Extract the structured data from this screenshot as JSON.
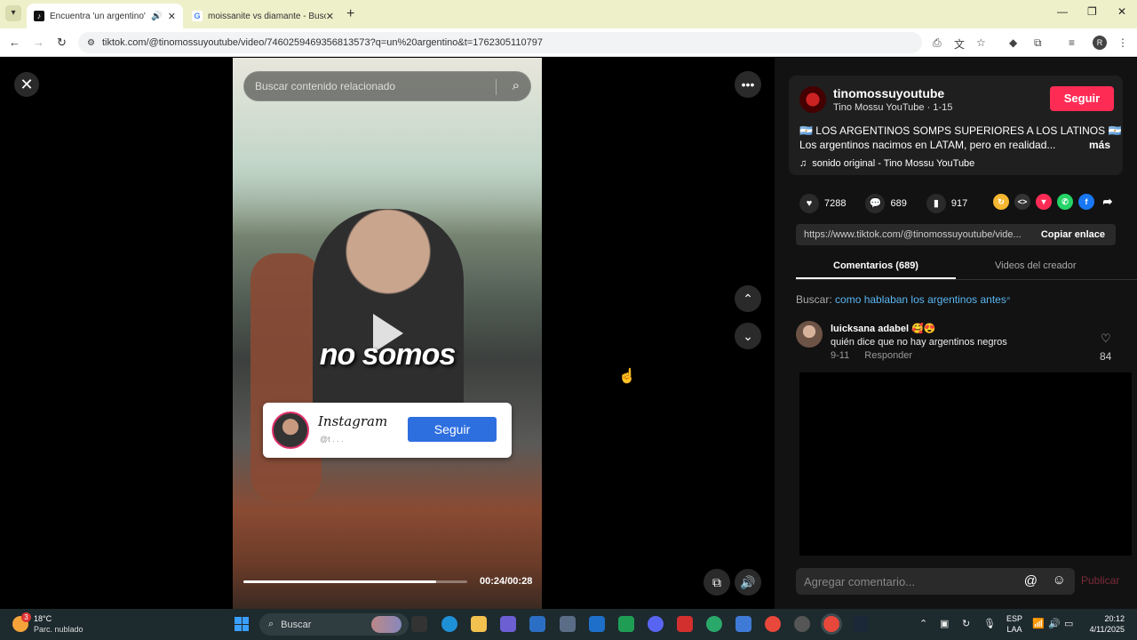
{
  "browser": {
    "tabs": [
      {
        "title": "Encuentra 'un argentino' en",
        "active": true
      },
      {
        "title": "moissanite vs diamante - Busca",
        "active": false
      }
    ],
    "new_tab": "+",
    "url": "tiktok.com/@tinomossuyoutube/video/7460259469356813573?q=un%20argentino&t=1762305110797"
  },
  "video": {
    "search_placeholder": "Buscar contenido relacionado",
    "caption": "no somos",
    "ig_card": {
      "name": "Instagram",
      "handle": "@t . . .",
      "follow": "Seguir"
    },
    "time": "00:24/00:28",
    "progress_fraction": 0.86
  },
  "panel": {
    "creator_name": "tinomossuyoutube",
    "creator_sub": "Tino Mossu YouTube · 1-15",
    "follow_label": "Seguir",
    "desc_line1": "🇦🇷 LOS ARGENTINOS SOMPS SUPERIORES A LOS LATINOS 🇦🇷",
    "desc_line2": "Los argentinos nacimos en LATAM, pero en realidad...",
    "more_label": "más",
    "sound": "sonido original - Tino Mossu YouTube",
    "likes": "7288",
    "comments": "689",
    "saves": "917",
    "share_link": "https://www.tiktok.com/@tinomossuyoutube/vide...",
    "copy_label": "Copiar enlace",
    "tab_comments": "Comentarios (689)",
    "tab_creator": "Videos del creador",
    "search_prefix": "Buscar:",
    "search_term": "como hablaban los argentinos antes",
    "comment": {
      "user": "luicksana adabel 🥰😍",
      "text": "quién dice que no hay argentinos negros",
      "date": "9-11",
      "reply": "Responder",
      "likes": "84"
    },
    "add_comment_placeholder": "Agregar comentario...",
    "publish_label": "Publicar"
  },
  "taskbar": {
    "weather_badge": "3",
    "temp": "18°C",
    "condition": "Parc. nublado",
    "search": "Buscar",
    "lang1": "ESP",
    "lang2": "LAA",
    "time": "20:12",
    "date": "4/11/2025"
  },
  "colors": {
    "accent": "#fe2c55",
    "link": "#59b6f1",
    "ig_button": "#2e6fe0"
  }
}
